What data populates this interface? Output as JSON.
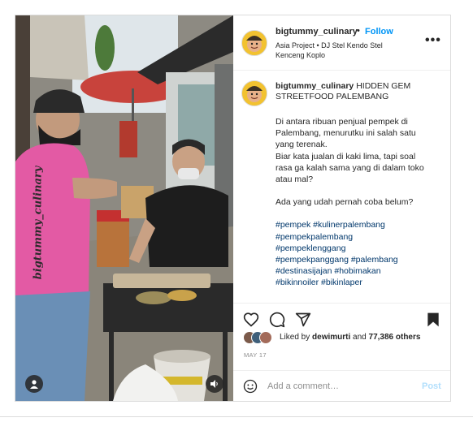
{
  "post": {
    "username": "bigtummy_culinary",
    "follow_label": "Follow",
    "separator": "•",
    "music": "Asia Project • DJ Stel Kendo Stel Kenceng Koplo",
    "more_label": "•••",
    "caption_title": "HIDDEN GEM STREETFOOD PALEMBANG",
    "caption_lines": [
      "Di antara ribuan penjual pempek di Palembang, menurutku ini salah satu yang terenak.\nBiar kata jualan di kaki lima, tapi soal rasa ga kalah sama yang di dalam toko atau mal?",
      "Ada yang udah pernah coba belum?"
    ],
    "hashtags": [
      "#pempek #kulinerpalembang",
      "#pempekpalembang",
      "#pempeklenggang",
      "#pempekpanggang #palembang",
      "#destinasijajan #hobimakan",
      "#bikinnoiler #bikinlaper"
    ],
    "likes_prefix": "Liked by",
    "likes_user": "dewimurti",
    "likes_conj": "and",
    "likes_count": "77,386 others",
    "date": "MAY 17",
    "comment_placeholder": "Add a comment…",
    "post_label": "Post"
  },
  "media": {
    "watermark": "bigtummy_culinary"
  },
  "icons": {
    "like": "heart-icon",
    "comment": "comment-icon",
    "share": "send-icon",
    "save": "bookmark-icon",
    "emoji": "smiley-icon",
    "user": "user-tag-icon",
    "audio": "speaker-icon"
  },
  "colors": {
    "link": "#0095f6",
    "hashtag": "#00376b",
    "post_disabled": "#b2dffc",
    "muted": "#8e8e8e"
  }
}
